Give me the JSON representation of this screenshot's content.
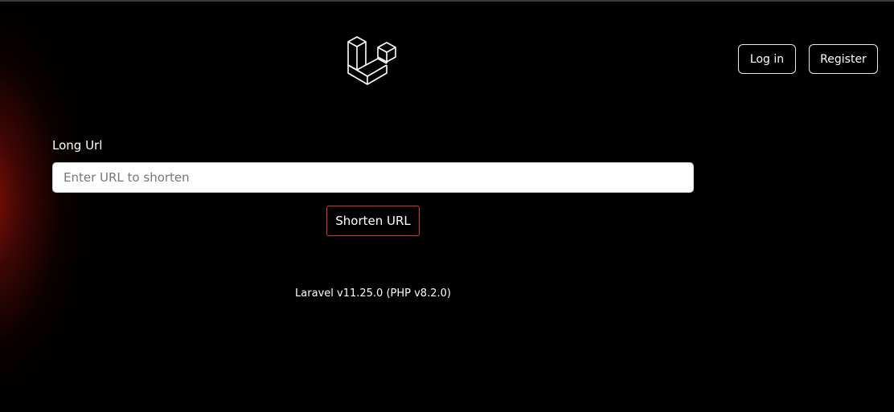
{
  "header": {
    "logo_icon": "laravel-logo-icon",
    "login_label": "Log in",
    "register_label": "Register"
  },
  "form": {
    "label": "Long Url",
    "input_placeholder": "Enter URL to shorten",
    "input_value": "",
    "submit_label": "Shorten URL"
  },
  "footer": {
    "version": "Laravel v11.25.0 (PHP v8.2.0)"
  },
  "colors": {
    "background": "#000000",
    "accent": "#e0372c",
    "text": "#ffffff"
  }
}
